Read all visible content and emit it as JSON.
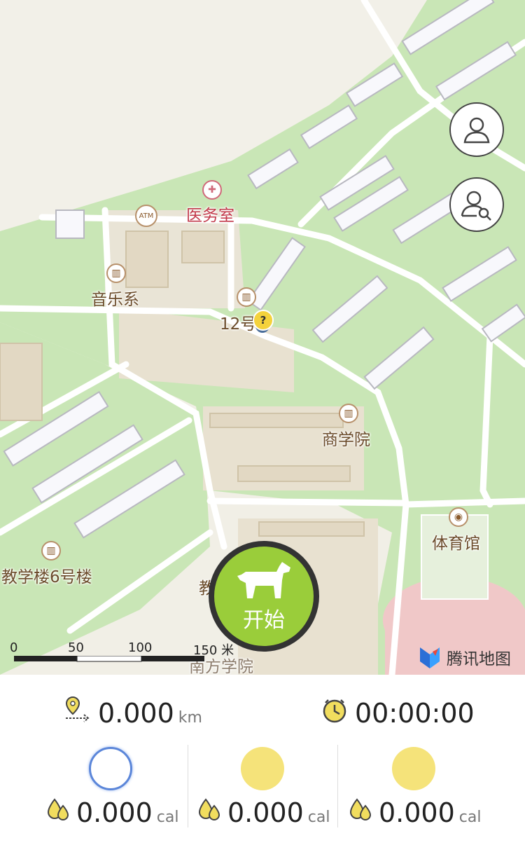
{
  "map": {
    "pois": [
      {
        "id": "clinic",
        "label": "医务室"
      },
      {
        "id": "music",
        "label": "音乐系"
      },
      {
        "id": "bldg12",
        "label": "12号"
      },
      {
        "id": "business",
        "label": "商学院"
      },
      {
        "id": "gym",
        "label": "体育馆"
      },
      {
        "id": "teach6",
        "label": "教学楼6号楼"
      },
      {
        "id": "teach-partial",
        "label": "教"
      },
      {
        "id": "south",
        "label": "南方学院"
      }
    ],
    "atm_label": "ATM",
    "marker_label": "?",
    "scale": {
      "labels": [
        "0",
        "50",
        "100",
        "150 米"
      ]
    },
    "brand": "腾讯地图",
    "start_button": "开始",
    "colors": {
      "park": "#c8e6b4",
      "road": "#ffffff",
      "land": "#f1efe6",
      "building": "#e3dccb",
      "accent": "#9acd3a"
    }
  },
  "stats": {
    "distance": {
      "value": "0.000",
      "unit": "km",
      "icon": "distance-pin-icon"
    },
    "time": {
      "value": "00:00:00",
      "icon": "clock-icon"
    },
    "calories": [
      {
        "value": "0.000",
        "unit": "cal",
        "state": "selected"
      },
      {
        "value": "0.000",
        "unit": "cal",
        "state": "normal"
      },
      {
        "value": "0.000",
        "unit": "cal",
        "state": "normal"
      }
    ]
  }
}
